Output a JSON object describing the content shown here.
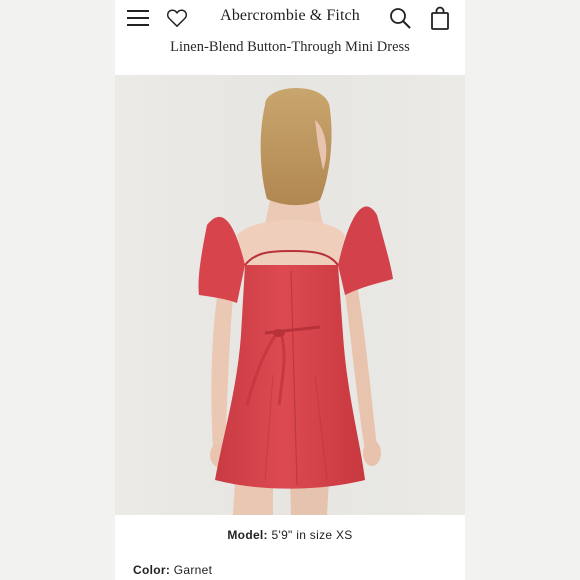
{
  "header": {
    "brand": "Abercrombie & Fitch",
    "icons": {
      "menu": "hamburger-menu-icon",
      "wishlist": "heart-icon",
      "search": "search-icon",
      "bag": "shopping-bag-icon"
    }
  },
  "product": {
    "title": "Linen-Blend Button-Through Mini Dress",
    "model_label": "Model:",
    "model_value": "5'9\" in size XS",
    "color_label": "Color:",
    "color_value": "Garnet"
  },
  "colors": {
    "dress": "#d8454d",
    "photo_background": "#e8e7e3",
    "page_background": "#ffffff"
  }
}
